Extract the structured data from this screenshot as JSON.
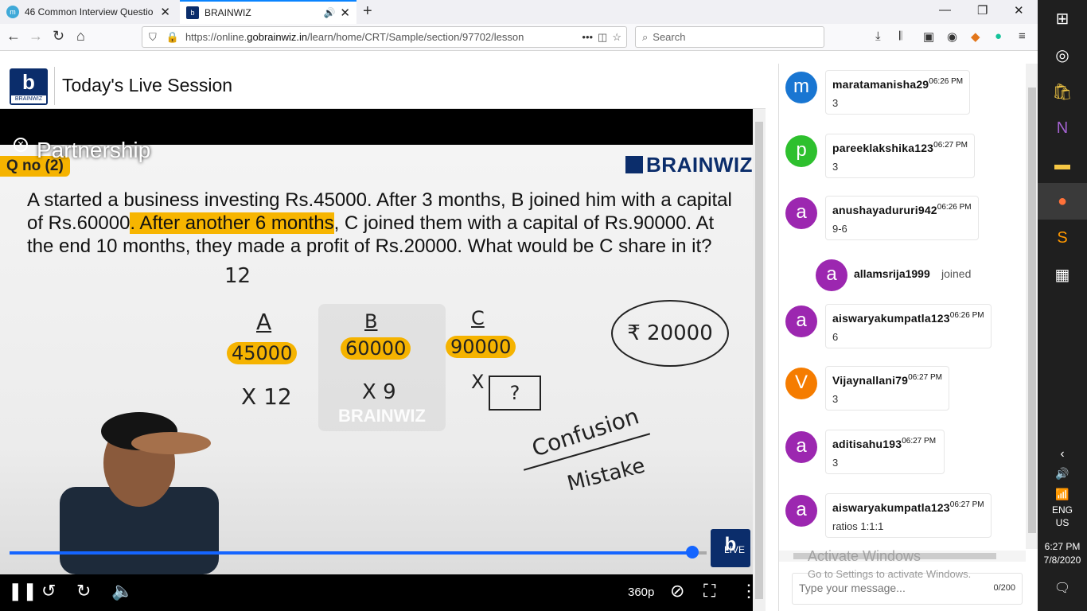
{
  "browser": {
    "tabs": [
      {
        "title": "46 Common Interview Questio",
        "favicon": "m"
      },
      {
        "title": "BRAINWIZ",
        "favicon": "b"
      }
    ],
    "url_prefix": "https://online.",
    "url_domain": "gobrainwiz.in",
    "url_path": "/learn/home/CRT/Sample/section/97702/lesson",
    "url_more": "•••",
    "search_placeholder": "Search"
  },
  "page": {
    "logo_text": "BRAINWIZ",
    "session_title": "Today's Live Session"
  },
  "video": {
    "title": "Partnership",
    "qno": "Q no (2)",
    "brand": "BRAINWIZ",
    "question_parts": [
      "A started a business investing Rs.45000. After 3 months, B joined him with a capital of Rs.60000",
      ". After another 6 months",
      ", C joined them with a capital of Rs.90000. At the end 10 months, they made a profit of Rs.20000. What would be C share in it?"
    ],
    "watermark": "BRAINWIZ",
    "handwriting": {
      "twelve": "12",
      "a": "A",
      "b": "B",
      "c": "C",
      "a_val": "45000",
      "b_val": "60000",
      "c_val": "90000",
      "x12": "X 12",
      "x9": "X 9",
      "x": "X",
      "q": "?",
      "total": "₹ 20000",
      "confusion": "Confusion",
      "mistake": "Mistake"
    },
    "live_label": "LIVE",
    "quality": "360p",
    "progress_percent": 98
  },
  "chat": {
    "messages": [
      {
        "initial": "m",
        "color": "#1976d2",
        "user": "maratamanisha29",
        "time": "06:26 PM",
        "text": "3"
      },
      {
        "initial": "p",
        "color": "#2ec02e",
        "user": "pareeklakshika123",
        "time": "06:27 PM",
        "text": "3"
      },
      {
        "initial": "a",
        "color": "#9c27b0",
        "user": "anushayadururi942",
        "time": "06:26 PM",
        "text": "9-6"
      },
      {
        "initial": "a",
        "color": "#9c27b0",
        "user": "aiswaryakumpatla123",
        "time": "06:26 PM",
        "text": "6"
      },
      {
        "initial": "V",
        "color": "#f57c00",
        "user": "Vijaynallani79",
        "time": "06:27 PM",
        "text": "3"
      },
      {
        "initial": "a",
        "color": "#9c27b0",
        "user": "aditisahu193",
        "time": "06:27 PM",
        "text": "3"
      },
      {
        "initial": "a",
        "color": "#9c27b0",
        "user": "aiswaryakumpatla123",
        "time": "06:27 PM",
        "text": "ratios 1:1:1"
      }
    ],
    "joined": {
      "initial": "a",
      "color": "#9c27b0",
      "user": "allamsrija1999",
      "label": "joined"
    },
    "activate_title": "Activate Windows",
    "activate_sub": "Go to Settings to activate Windows.",
    "input_placeholder": "Type your message...",
    "counter": "0/200"
  },
  "taskbar": {
    "lang1": "ENG",
    "lang2": "US",
    "time": "6:27 PM",
    "date": "7/8/2020"
  }
}
